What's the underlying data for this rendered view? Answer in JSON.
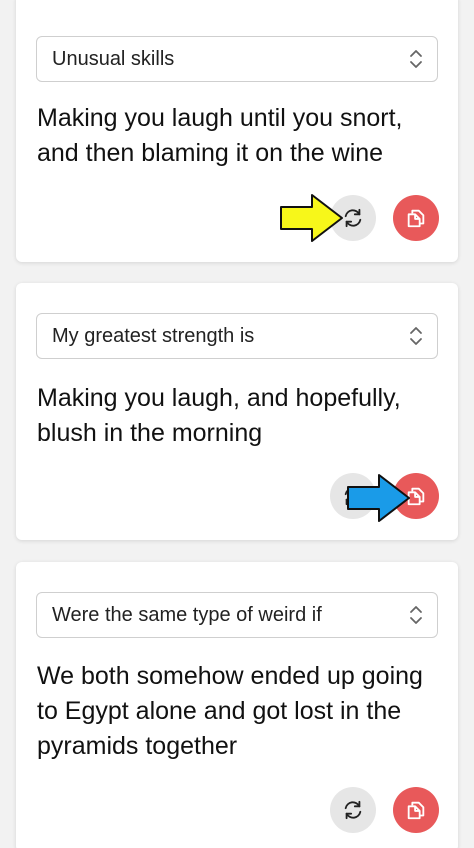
{
  "cards": [
    {
      "category": "Unusual skills",
      "phrase": "Making you laugh until you snort, and then blaming it on the wine"
    },
    {
      "category": "My greatest strength is",
      "phrase": "Making you laugh, and hopefully, blush in the morning"
    },
    {
      "category": "Were the same type of weird if",
      "phrase": "We both somehow ended up going to Egypt alone and got lost in the pyramids together"
    }
  ],
  "icons": {
    "select_chevron": "chevron-updown-icon",
    "refresh": "refresh-icon",
    "copy": "copy-icon",
    "annotation_yellow": "arrow-pointer-icon",
    "annotation_blue": "arrow-pointer-icon"
  },
  "colors": {
    "background": "#f2f2f2",
    "card": "#ffffff",
    "refresh_button": "#e6e6e6",
    "copy_button": "#e8595a",
    "arrow_yellow": "#f7f71a",
    "arrow_blue": "#1a9be8"
  }
}
